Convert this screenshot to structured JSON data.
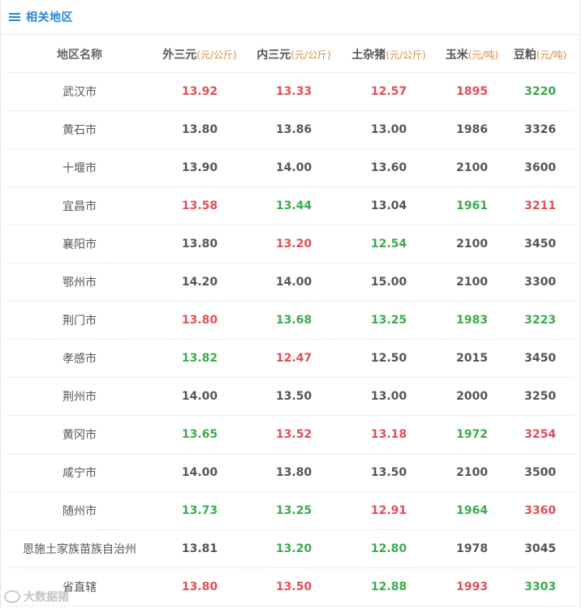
{
  "header": {
    "icon": "menu-icon",
    "title": "相关地区"
  },
  "table": {
    "columns": [
      {
        "label": "地区名称",
        "unit": ""
      },
      {
        "label": "外三元",
        "unit": "(元/公斤)"
      },
      {
        "label": "内三元",
        "unit": "(元/公斤)"
      },
      {
        "label": "土杂猪",
        "unit": "(元/公斤)"
      },
      {
        "label": "玉米",
        "unit": "(元/吨)"
      },
      {
        "label": "豆粕",
        "unit": "(元/吨)"
      }
    ],
    "rows": [
      {
        "region": "武汉市",
        "cells": [
          {
            "v": "13.92",
            "c": "red"
          },
          {
            "v": "13.33",
            "c": "red"
          },
          {
            "v": "12.57",
            "c": "red"
          },
          {
            "v": "1895",
            "c": "red"
          },
          {
            "v": "3220",
            "c": "green"
          }
        ]
      },
      {
        "region": "黄石市",
        "cells": [
          {
            "v": "13.80",
            "c": "neutral"
          },
          {
            "v": "13.86",
            "c": "neutral"
          },
          {
            "v": "13.00",
            "c": "neutral"
          },
          {
            "v": "1986",
            "c": "neutral"
          },
          {
            "v": "3326",
            "c": "neutral"
          }
        ]
      },
      {
        "region": "十堰市",
        "cells": [
          {
            "v": "13.90",
            "c": "neutral"
          },
          {
            "v": "14.00",
            "c": "neutral"
          },
          {
            "v": "13.60",
            "c": "neutral"
          },
          {
            "v": "2100",
            "c": "neutral"
          },
          {
            "v": "3600",
            "c": "neutral"
          }
        ]
      },
      {
        "region": "宜昌市",
        "cells": [
          {
            "v": "13.58",
            "c": "red"
          },
          {
            "v": "13.44",
            "c": "green"
          },
          {
            "v": "13.04",
            "c": "neutral"
          },
          {
            "v": "1961",
            "c": "green"
          },
          {
            "v": "3211",
            "c": "red"
          }
        ]
      },
      {
        "region": "襄阳市",
        "cells": [
          {
            "v": "13.80",
            "c": "neutral"
          },
          {
            "v": "13.20",
            "c": "red"
          },
          {
            "v": "12.54",
            "c": "green"
          },
          {
            "v": "2100",
            "c": "neutral"
          },
          {
            "v": "3450",
            "c": "neutral"
          }
        ]
      },
      {
        "region": "鄂州市",
        "cells": [
          {
            "v": "14.20",
            "c": "neutral"
          },
          {
            "v": "14.00",
            "c": "neutral"
          },
          {
            "v": "15.00",
            "c": "neutral"
          },
          {
            "v": "2100",
            "c": "neutral"
          },
          {
            "v": "3300",
            "c": "neutral"
          }
        ]
      },
      {
        "region": "荆门市",
        "cells": [
          {
            "v": "13.80",
            "c": "red"
          },
          {
            "v": "13.68",
            "c": "green"
          },
          {
            "v": "13.25",
            "c": "green"
          },
          {
            "v": "1983",
            "c": "green"
          },
          {
            "v": "3223",
            "c": "green"
          }
        ]
      },
      {
        "region": "孝感市",
        "cells": [
          {
            "v": "13.82",
            "c": "green"
          },
          {
            "v": "12.47",
            "c": "red"
          },
          {
            "v": "12.50",
            "c": "neutral"
          },
          {
            "v": "2015",
            "c": "neutral"
          },
          {
            "v": "3450",
            "c": "neutral"
          }
        ]
      },
      {
        "region": "荆州市",
        "cells": [
          {
            "v": "14.00",
            "c": "neutral"
          },
          {
            "v": "13.50",
            "c": "neutral"
          },
          {
            "v": "13.00",
            "c": "neutral"
          },
          {
            "v": "2000",
            "c": "neutral"
          },
          {
            "v": "3250",
            "c": "neutral"
          }
        ]
      },
      {
        "region": "黄冈市",
        "cells": [
          {
            "v": "13.65",
            "c": "green"
          },
          {
            "v": "13.52",
            "c": "red"
          },
          {
            "v": "13.18",
            "c": "red"
          },
          {
            "v": "1972",
            "c": "green"
          },
          {
            "v": "3254",
            "c": "red"
          }
        ]
      },
      {
        "region": "咸宁市",
        "cells": [
          {
            "v": "14.00",
            "c": "neutral"
          },
          {
            "v": "13.80",
            "c": "neutral"
          },
          {
            "v": "13.50",
            "c": "neutral"
          },
          {
            "v": "2100",
            "c": "neutral"
          },
          {
            "v": "3500",
            "c": "neutral"
          }
        ]
      },
      {
        "region": "随州市",
        "cells": [
          {
            "v": "13.73",
            "c": "green"
          },
          {
            "v": "13.25",
            "c": "green"
          },
          {
            "v": "12.91",
            "c": "red"
          },
          {
            "v": "1964",
            "c": "green"
          },
          {
            "v": "3360",
            "c": "red"
          }
        ]
      },
      {
        "region": "恩施土家族苗族自治州",
        "cells": [
          {
            "v": "13.81",
            "c": "neutral"
          },
          {
            "v": "13.20",
            "c": "green"
          },
          {
            "v": "12.80",
            "c": "green"
          },
          {
            "v": "1978",
            "c": "neutral"
          },
          {
            "v": "3045",
            "c": "neutral"
          }
        ]
      },
      {
        "region": "省直辖",
        "cells": [
          {
            "v": "13.80",
            "c": "red"
          },
          {
            "v": "13.50",
            "c": "red"
          },
          {
            "v": "12.88",
            "c": "green"
          },
          {
            "v": "1993",
            "c": "red"
          },
          {
            "v": "3303",
            "c": "green"
          }
        ]
      }
    ]
  },
  "watermark": {
    "text": "大数据猪"
  },
  "colors": {
    "accent": "#2a86d6",
    "up": "#e14e57",
    "down": "#3daa4e",
    "unit": "#e08a3c"
  }
}
